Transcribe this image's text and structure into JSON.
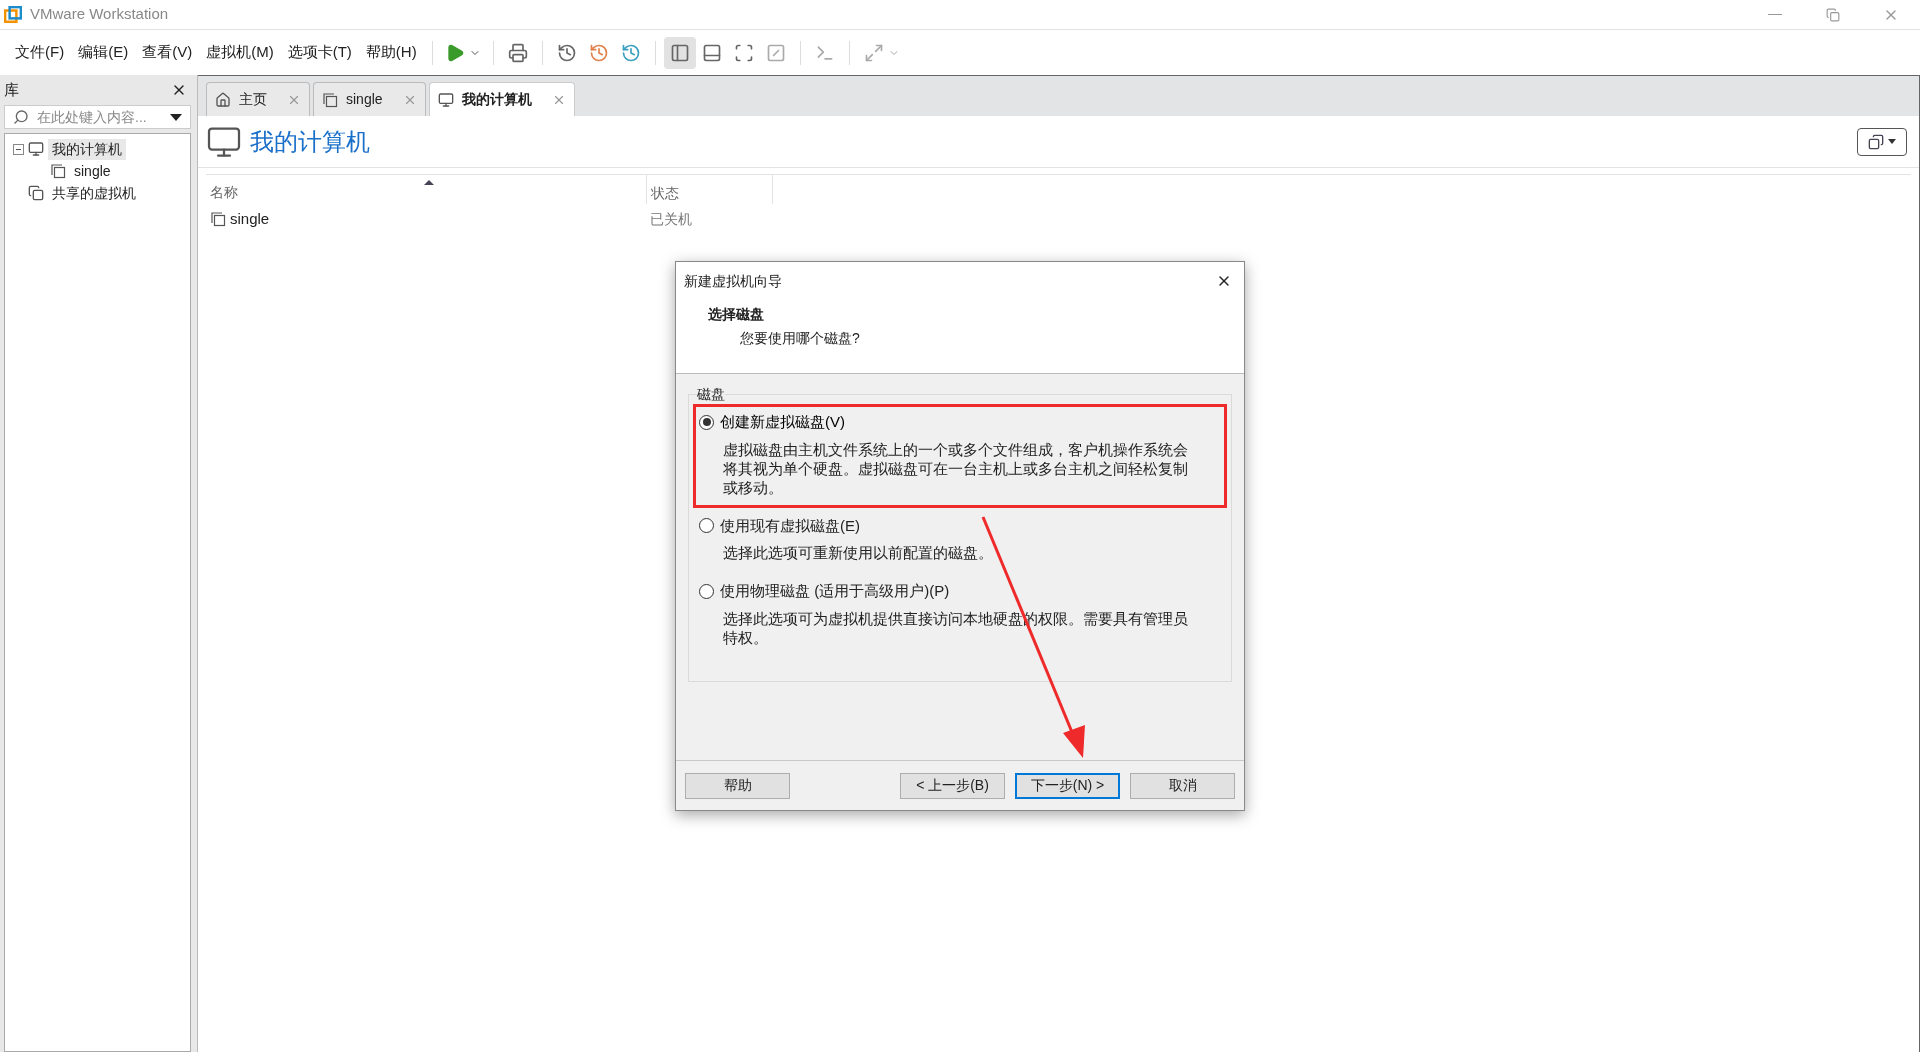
{
  "window": {
    "title": "VMware Workstation"
  },
  "menu": [
    "文件(F)",
    "编辑(E)",
    "查看(V)",
    "虚拟机(M)",
    "选项卡(T)",
    "帮助(H)"
  ],
  "library": {
    "title": "库",
    "search": {
      "placeholder": "在此处键入内容..."
    },
    "tree": [
      {
        "label": "我的计算机",
        "kind": "computer",
        "selected": true,
        "expanded": true,
        "children": [
          {
            "label": "single",
            "kind": "vm",
            "selected": false
          }
        ]
      },
      {
        "label": "共享的虚拟机",
        "kind": "shared",
        "selected": false
      }
    ]
  },
  "tabs": [
    {
      "label": "主页",
      "kind": "home",
      "selected": false
    },
    {
      "label": "single",
      "kind": "vm",
      "selected": false
    },
    {
      "label": "我的计算机",
      "kind": "computer",
      "selected": true
    }
  ],
  "page": {
    "title": "我的计算机",
    "columns": [
      "名称",
      "状态"
    ],
    "rows": [
      {
        "name": "single",
        "status": "已关机"
      }
    ]
  },
  "dialog": {
    "title": "新建虚拟机向导",
    "heading": "选择磁盘",
    "subheading": "您要使用哪个磁盘?",
    "group": "磁盘",
    "options": [
      {
        "label": "创建新虚拟磁盘(V)",
        "selected": true,
        "description": "虚拟磁盘由主机文件系统上的一个或多个文件组成，客户机操作系统会将其视为单个硬盘。虚拟磁盘可在一台主机上或多台主机之间轻松复制或移动。"
      },
      {
        "label": "使用现有虚拟磁盘(E)",
        "selected": false,
        "description": "选择此选项可重新使用以前配置的磁盘。"
      },
      {
        "label": "使用物理磁盘 (适用于高级用户)(P)",
        "selected": false,
        "description": "选择此选项可为虚拟机提供直接访问本地硬盘的权限。需要具有管理员特权。"
      }
    ],
    "buttons": [
      {
        "label": "帮助",
        "default": false
      },
      {
        "label": "< 上一步(B)",
        "default": false
      },
      {
        "label": "下一步(N) >",
        "default": true
      },
      {
        "label": "取消",
        "default": false
      }
    ]
  }
}
